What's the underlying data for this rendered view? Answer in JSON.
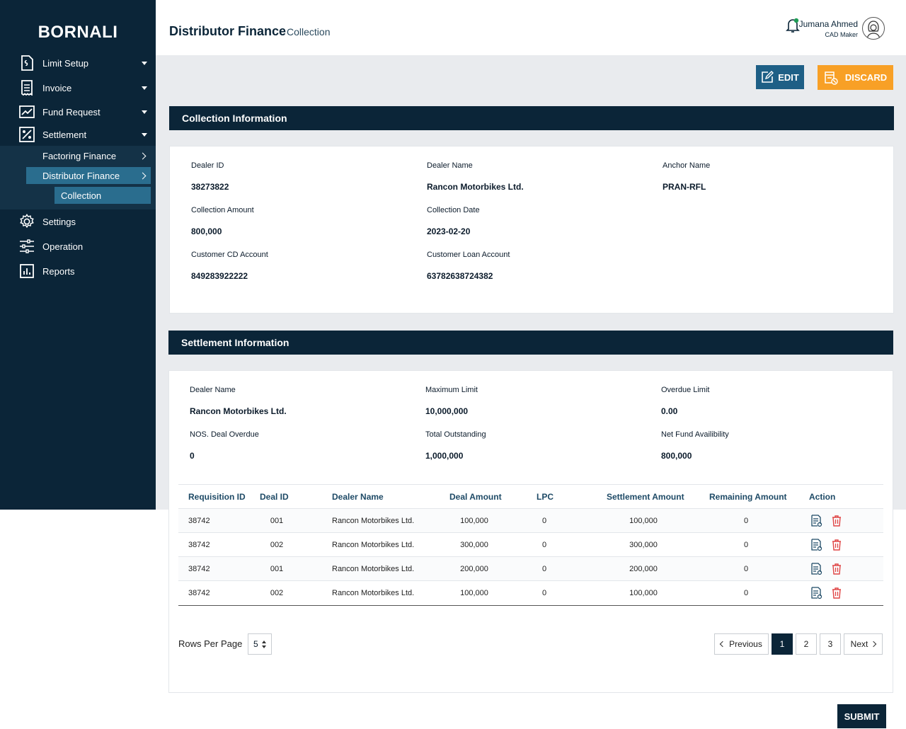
{
  "brand": "BORNALI",
  "sidebar": {
    "items": [
      {
        "label": "Limit Setup"
      },
      {
        "label": "Invoice"
      },
      {
        "label": "Fund Request"
      },
      {
        "label": "Settlement"
      },
      {
        "label": "Settings"
      },
      {
        "label": "Operation"
      },
      {
        "label": "Reports"
      }
    ],
    "sub": {
      "factoring": "Factoring Finance",
      "distributor": "Distributor Finance",
      "collection": "Collection"
    }
  },
  "header": {
    "title": "Distributor Finance",
    "subtitle": "Collection",
    "user_name": "Jumana Ahmed",
    "user_role": "CAD Maker"
  },
  "actions": {
    "edit": "EDIT",
    "discard": "DISCARD",
    "submit": "SUBMIT"
  },
  "collection": {
    "title": "Collection Information",
    "dealer_id_label": "Dealer ID",
    "dealer_id": "38273822",
    "dealer_name_label": "Dealer Name",
    "dealer_name": "Rancon Motorbikes Ltd.",
    "anchor_label": "Anchor Name",
    "anchor": "PRAN-RFL",
    "amount_label": "Collection Amount",
    "amount": "800,000",
    "date_label": "Collection Date",
    "date": "2023-02-20",
    "cd_label": "Customer CD Account",
    "cd": "849283922222",
    "loan_label": "Customer Loan Account",
    "loan": "63782638724382"
  },
  "settlement": {
    "title": "Settlement Information",
    "dealer_name_label": "Dealer Name",
    "dealer_name": "Rancon Motorbikes Ltd.",
    "max_limit_label": "Maximum Limit",
    "max_limit": "10,000,000",
    "overdue_limit_label": "Overdue Limit",
    "overdue_limit": "0.00",
    "nos_label": "NOS. Deal Overdue",
    "nos": "0",
    "outstanding_label": "Total Outstanding",
    "outstanding": "1,000,000",
    "net_fund_label": "Net Fund Availibility",
    "net_fund": "800,000"
  },
  "table": {
    "headers": {
      "req": "Requisition ID",
      "deal": "Deal ID",
      "dealer": "Dealer Name",
      "amount": "Deal Amount",
      "lpc": "LPC",
      "settle": "Settlement Amount",
      "remaining": "Remaining Amount",
      "action": "Action"
    },
    "rows": [
      {
        "req": "38742",
        "deal": "001",
        "dealer": "Rancon Motorbikes Ltd.",
        "amount": "100,000",
        "lpc": "0",
        "settle": "100,000",
        "remaining": "0"
      },
      {
        "req": "38742",
        "deal": "002",
        "dealer": "Rancon Motorbikes Ltd.",
        "amount": "300,000",
        "lpc": "0",
        "settle": "300,000",
        "remaining": "0"
      },
      {
        "req": "38742",
        "deal": "001",
        "dealer": "Rancon Motorbikes Ltd.",
        "amount": "200,000",
        "lpc": "0",
        "settle": "200,000",
        "remaining": "0"
      },
      {
        "req": "38742",
        "deal": "002",
        "dealer": "Rancon Motorbikes Ltd.",
        "amount": "100,000",
        "lpc": "0",
        "settle": "100,000",
        "remaining": "0"
      }
    ]
  },
  "pagination": {
    "rows_label": "Rows Per Page",
    "rows_value": "5",
    "previous": "Previous",
    "next": "Next",
    "pages": [
      "1",
      "2",
      "3"
    ]
  }
}
